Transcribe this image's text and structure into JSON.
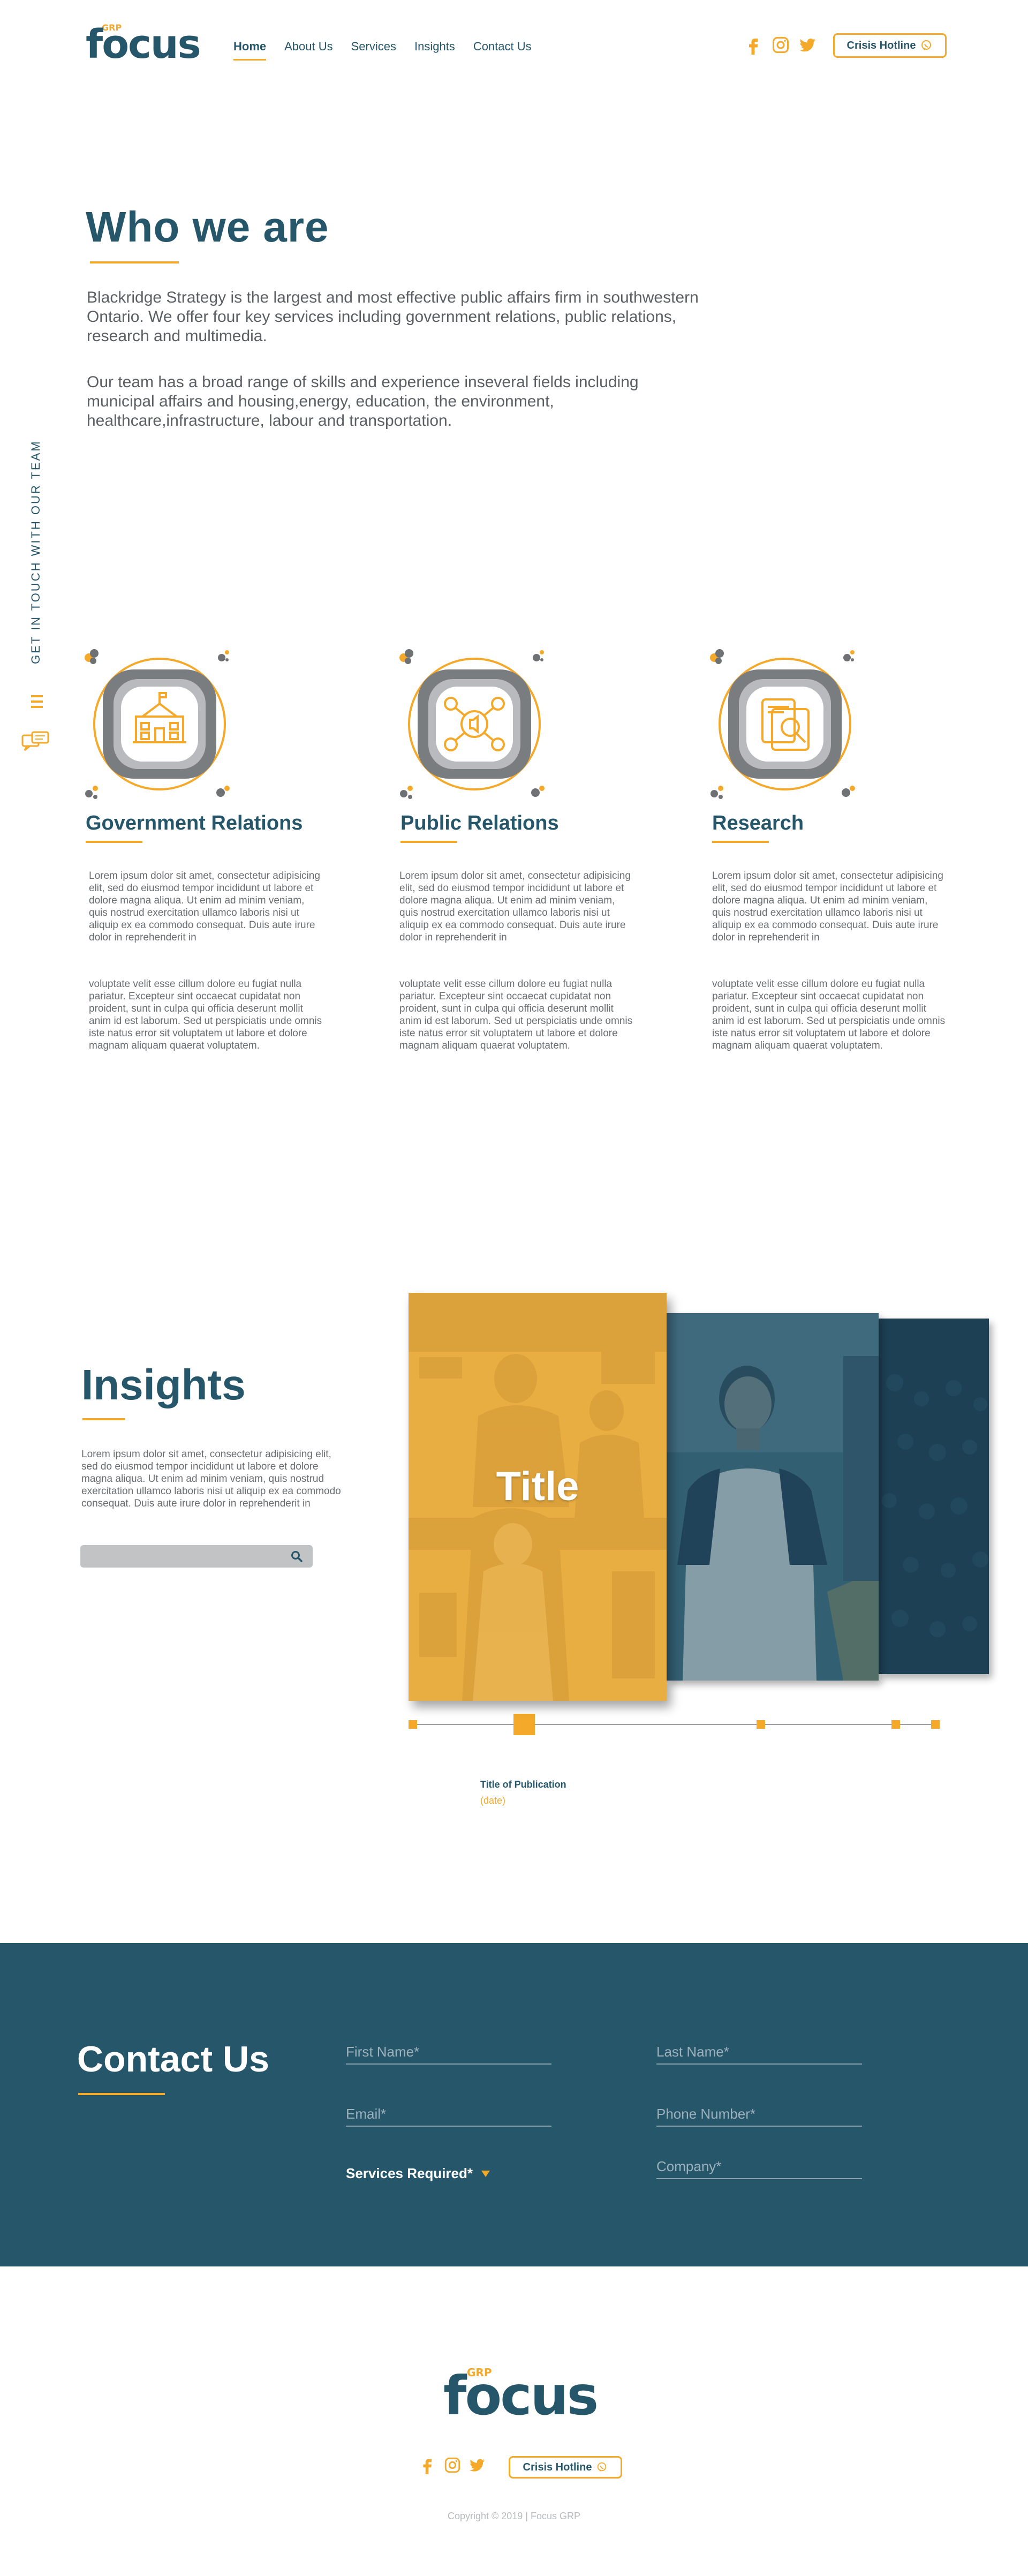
{
  "brand": {
    "grp": "GRP",
    "name": "focus"
  },
  "nav": [
    {
      "label": "Home",
      "active": true
    },
    {
      "label": "About Us"
    },
    {
      "label": "Services"
    },
    {
      "label": "Insights"
    },
    {
      "label": "Contact Us"
    }
  ],
  "social": {
    "icons": [
      "facebook-icon",
      "instagram-icon",
      "twitter-icon"
    ]
  },
  "hotline": {
    "label": "Crisis Hotline"
  },
  "side_tab": {
    "label": "GET IN TOUCH WITH OUR TEAM"
  },
  "about": {
    "title": "Who we are",
    "paragraph1": "Blackridge Strategy is the largest and most effective public affairs firm in southwestern Ontario. We offer four key services including government relations, public relations, research and multimedia.",
    "paragraph2": "Our team has a broad range of skills and experience inseveral fields including municipal affairs and housing,energy, education, the environment, healthcare,infrastructure, labour and transportation."
  },
  "services": [
    {
      "title": "Government Relations",
      "text1": "Lorem ipsum dolor sit amet, consectetur adipisicing elit, sed do eiusmod tempor incididunt ut labore et dolore magna aliqua. Ut enim ad minim veniam, quis nostrud exercitation ullamco laboris nisi ut aliquip ex ea commodo consequat. Duis aute irure dolor in reprehenderit in",
      "text2": "voluptate velit esse cillum dolore eu fugiat nulla pariatur. Excepteur sint occaecat cupidatat non proident, sunt in culpa qui officia deserunt mollit anim id est laborum. Sed ut perspiciatis unde omnis iste natus error sit voluptatem ut labore et dolore magnam aliquam quaerat voluptatem."
    },
    {
      "title": "Public Relations",
      "text1": "Lorem ipsum dolor sit amet, consectetur adipisicing elit, sed do eiusmod tempor incididunt ut labore et dolore magna aliqua. Ut enim ad minim veniam, quis nostrud exercitation ullamco laboris nisi ut aliquip ex ea commodo consequat. Duis aute irure dolor in reprehenderit in",
      "text2": "voluptate velit esse cillum dolore eu fugiat nulla pariatur. Excepteur sint occaecat cupidatat non proident, sunt in culpa qui officia deserunt mollit anim id est laborum. Sed ut perspiciatis unde omnis iste natus error sit voluptatem ut labore et dolore magnam aliquam quaerat voluptatem."
    },
    {
      "title": "Research",
      "text1": "Lorem ipsum dolor sit amet, consectetur adipisicing elit, sed do eiusmod tempor incididunt ut labore et dolore magna aliqua. Ut enim ad minim veniam, quis nostrud exercitation ullamco laboris nisi ut aliquip ex ea commodo consequat. Duis aute irure dolor in reprehenderit in",
      "text2": "voluptate velit esse cillum dolore eu fugiat nulla pariatur. Excepteur sint occaecat cupidatat non proident, sunt in culpa qui officia deserunt mollit anim id est laborum. Sed ut perspiciatis unde omnis iste natus error sit voluptatem ut labore et dolore magnam aliquam quaerat voluptatem."
    }
  ],
  "insights": {
    "title": "Insights",
    "text": "Lorem ipsum dolor sit amet, consectetur adipisicing elit, sed do eiusmod tempor incididunt ut labore et dolore magna aliqua. Ut enim ad minim veniam, quis nostrud exercitation ullamco laboris nisi ut aliquip ex ea commodo consequat. Duis aute irure dolor in reprehenderit in",
    "search_placeholder": "",
    "card_title": "Title",
    "publication_title": "Title of Publication",
    "publication_date": "(date)"
  },
  "contact": {
    "title": "Contact Us",
    "first_name": "First Name*",
    "last_name": "Last Name*",
    "email": "Email*",
    "phone": "Phone Number*",
    "services": "Services Required*",
    "company": "Company*"
  },
  "footer": {
    "copyright": "Copyright © 2019 | Focus GRP"
  },
  "colors": {
    "primary": "#26566a",
    "accent": "#f4a92a",
    "text": "#5b5f63"
  }
}
